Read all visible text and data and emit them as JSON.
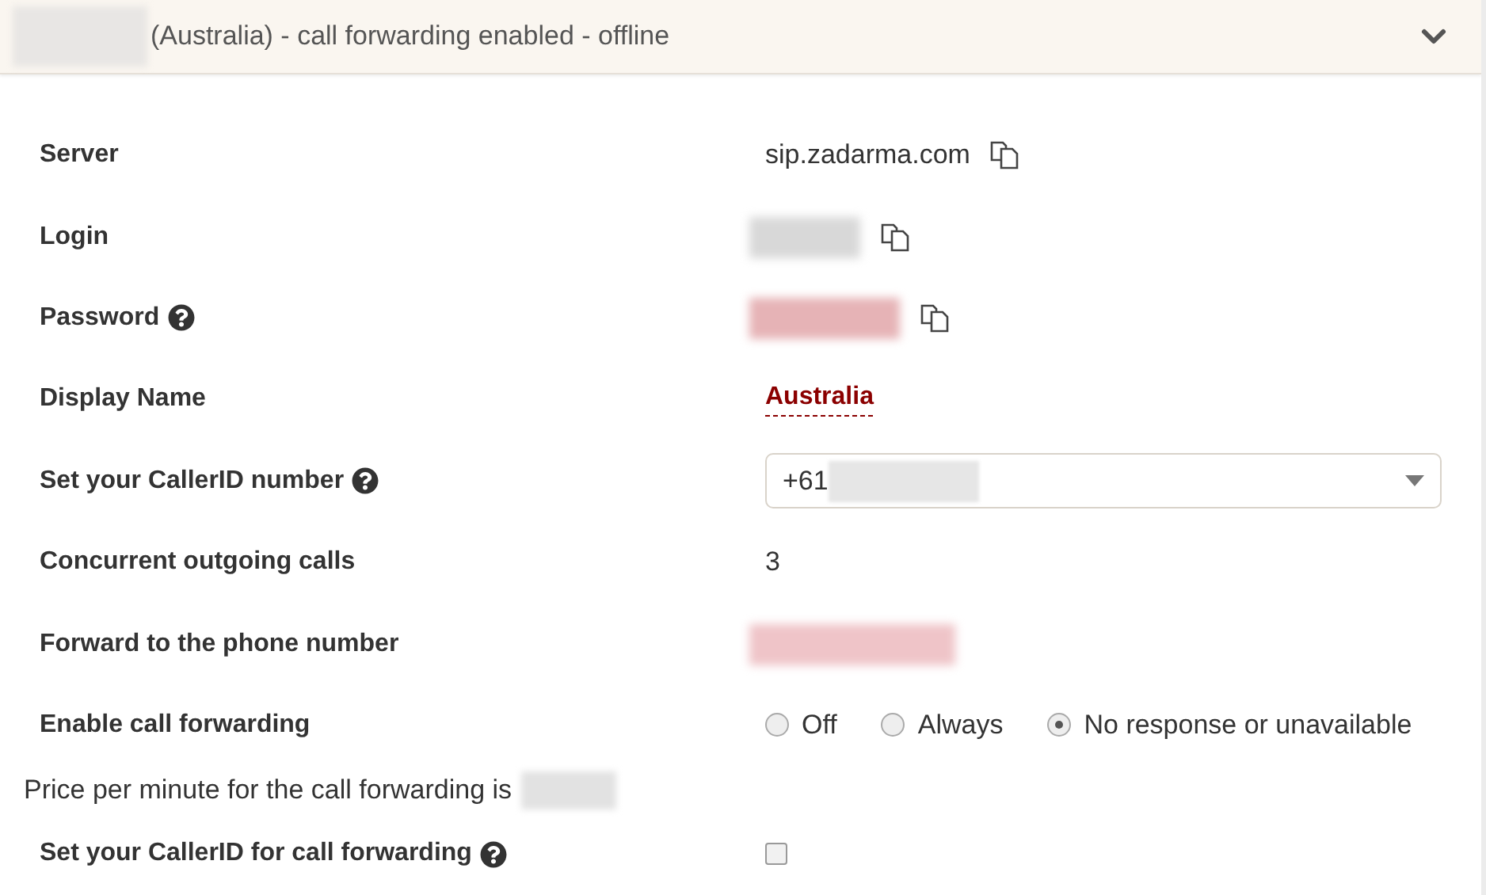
{
  "header": {
    "title": "(Australia) - call forwarding enabled - offline",
    "expanded": true
  },
  "rows": [
    {
      "label": "Server",
      "help": false,
      "kind": "text",
      "value": "sip.zadarma.com",
      "copyable": true
    },
    {
      "label": "Login",
      "help": false,
      "kind": "blurred",
      "color": "#d8d8d8",
      "copyable": true
    },
    {
      "label": "Password",
      "help": true,
      "kind": "blurred",
      "color": "#e6b3b6",
      "copyable": true
    },
    {
      "label": "Display Name",
      "help": false,
      "kind": "link",
      "value": "Australia",
      "copyable": false
    },
    {
      "label": "Set your CallerID number",
      "help": true,
      "kind": "select",
      "value": "+61",
      "copyable": false
    },
    {
      "label": "Concurrent outgoing calls",
      "help": false,
      "kind": "text",
      "value": "3",
      "copyable": false
    },
    {
      "label": "Forward to the phone number",
      "help": false,
      "kind": "blurred",
      "color": "#efc4c8",
      "copyable": false
    },
    {
      "label": "Enable call forwarding",
      "help": false,
      "kind": "radio",
      "copyable": false,
      "options": [
        {
          "label": "Off",
          "selected": false
        },
        {
          "label": "Always",
          "selected": false
        },
        {
          "label": "No response or unavailable",
          "selected": true
        }
      ]
    },
    {
      "kind": "note",
      "text": "Price per minute for the call forwarding is"
    },
    {
      "label": "Set your CallerID for call forwarding",
      "help": true,
      "kind": "checkbox",
      "checked": false,
      "copyable": false
    }
  ]
}
